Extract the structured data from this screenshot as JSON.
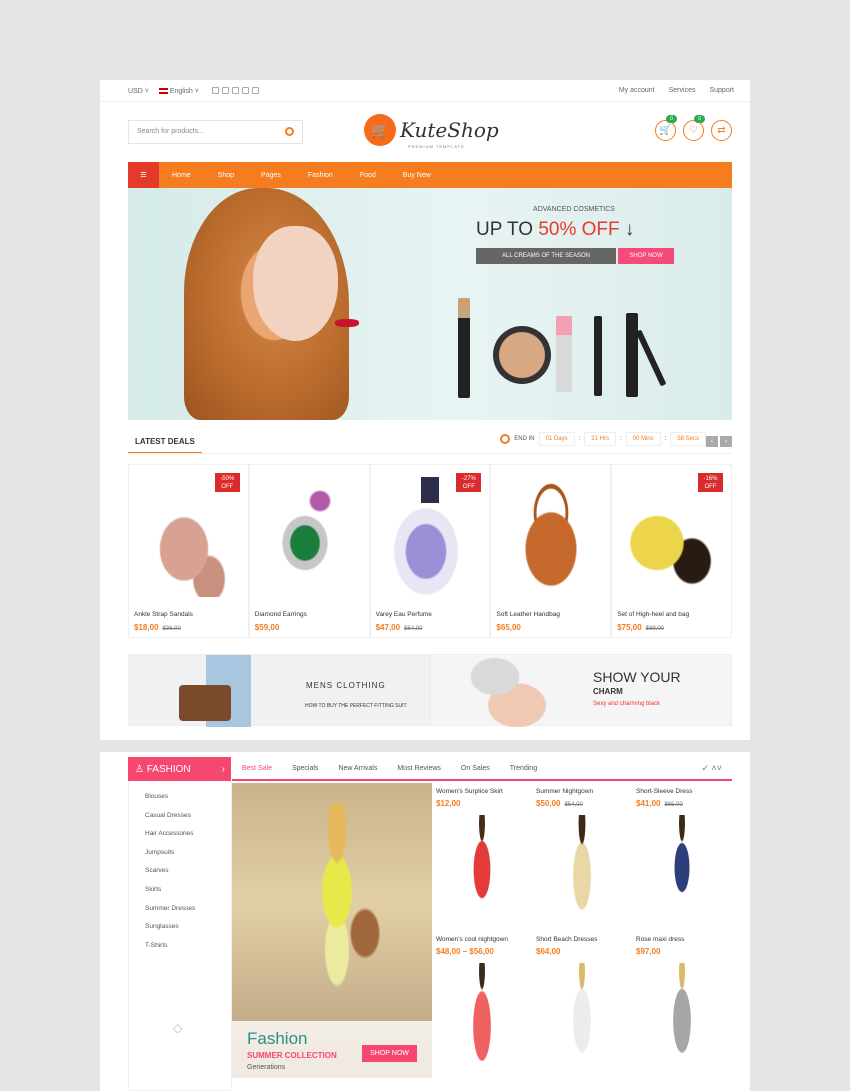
{
  "topbar": {
    "currency": "USD",
    "language": "English",
    "links": [
      "My account",
      "Services",
      "Support"
    ]
  },
  "header": {
    "search_placeholder": "Search for products...",
    "logo": "KuteShop",
    "logo_sub": "PREMIUM TEMPLATE",
    "cart_count": "0",
    "wish_count": "0"
  },
  "nav": {
    "items": [
      "Home",
      "Shop",
      "Pages",
      "Fashion",
      "Food",
      "Buy New"
    ]
  },
  "hero": {
    "sup": "ADVANCED COSMETICS",
    "big_prefix": "UP TO ",
    "big_highlight": "50% OFF",
    "grey": "ALL CREAMS OF THE SEASON",
    "shop": "SHOP NOW"
  },
  "deals": {
    "title": "LATEST DEALS",
    "end_label": "END IN",
    "timer": [
      "01 Days",
      "21 Hrs",
      "00 Mins",
      "58 Secs"
    ]
  },
  "products": [
    {
      "name": "Ankle Strap Sandals",
      "price": "$18,00",
      "old": "$36,00",
      "discount": [
        "-50%",
        "OFF"
      ]
    },
    {
      "name": "Diamond Earrings",
      "price": "$59,00",
      "old": "",
      "discount": null
    },
    {
      "name": "Varey Eau Perfume",
      "price": "$47,00",
      "old": "$64,00",
      "discount": [
        "-27%",
        "OFF"
      ]
    },
    {
      "name": "Soft Leather Handbag",
      "price": "$65,00",
      "old": "",
      "discount": null
    },
    {
      "name": "Set of High-heel and bag",
      "price": "$75,00",
      "old": "$89,00",
      "discount": [
        "-16%",
        "OFF"
      ]
    }
  ],
  "promo1": {
    "title": "MENS CLOTHING",
    "sub": "HOW TO BUY THE PERFECT FITTING SUIT"
  },
  "promo2": {
    "title": "SHOW YOUR",
    "bold": "CHARM",
    "sub": "Sexy and charming black"
  },
  "fashion": {
    "title": "FASHION",
    "tabs": [
      "Best Sale",
      "Specials",
      "New Arrivals",
      "Most Reviews",
      "On Sales",
      "Trending"
    ],
    "categories": [
      "Blouses",
      "Casual Dresses",
      "Hair Accessories",
      "Jumpsuits",
      "Scarves",
      "Skirts",
      "Summer Dresses",
      "Sunglasses",
      "T-Shirts"
    ],
    "banner": {
      "title": "Fashion",
      "collection": "SUMMER COLLECTION",
      "gen": "Generations",
      "btn": "SHOP NOW"
    },
    "items": [
      {
        "name": "Women's Surplice Skirt",
        "price": "$12,00",
        "old": ""
      },
      {
        "name": "Summer Nightgown",
        "price": "$50,00",
        "old": "$54,00"
      },
      {
        "name": "Short-Sleeve Dress",
        "price": "$41,00",
        "old": "$65,00"
      },
      {
        "name": "Women's cool nightgown",
        "price": "$48,00 – $56,00",
        "old": ""
      },
      {
        "name": "Short Beach Dresses",
        "price": "$64,00",
        "old": ""
      },
      {
        "name": "Rose maxi dress",
        "price": "$97,00",
        "old": ""
      }
    ]
  },
  "colors": {
    "accent": "#f57c1f",
    "pink": "#f5476f",
    "red": "#e43a2a"
  }
}
